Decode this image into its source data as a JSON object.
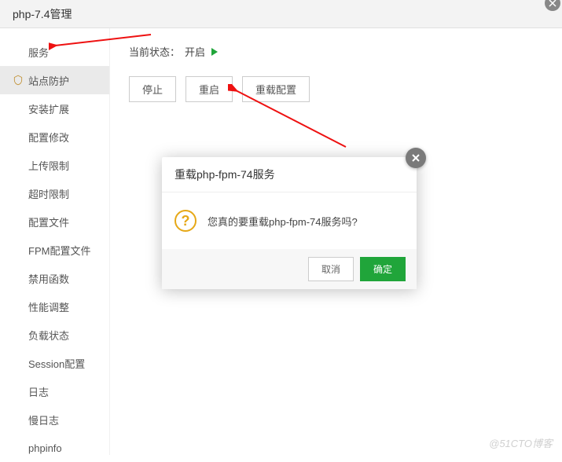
{
  "header": {
    "title": "php-7.4管理"
  },
  "sidebar": {
    "items": [
      {
        "label": "服务"
      },
      {
        "label": "站点防护"
      },
      {
        "label": "安装扩展"
      },
      {
        "label": "配置修改"
      },
      {
        "label": "上传限制"
      },
      {
        "label": "超时限制"
      },
      {
        "label": "配置文件"
      },
      {
        "label": "FPM配置文件"
      },
      {
        "label": "禁用函数"
      },
      {
        "label": "性能调整"
      },
      {
        "label": "负载状态"
      },
      {
        "label": "Session配置"
      },
      {
        "label": "日志"
      },
      {
        "label": "慢日志"
      },
      {
        "label": "phpinfo"
      }
    ]
  },
  "main": {
    "status_label": "当前状态：",
    "status_value": "开启",
    "buttons": {
      "stop": "停止",
      "restart": "重启",
      "reload": "重载配置"
    }
  },
  "modal": {
    "title": "重载php-fpm-74服务",
    "message": "您真的要重载php-fpm-74服务吗?",
    "cancel": "取消",
    "confirm": "确定"
  },
  "watermark": "@51CTO博客"
}
